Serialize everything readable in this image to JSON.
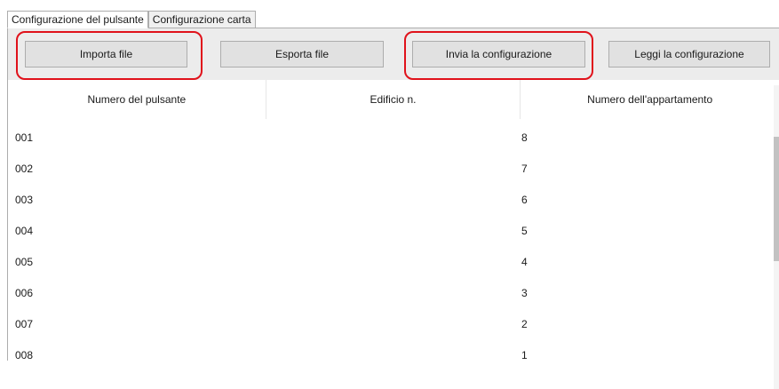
{
  "tabs": [
    {
      "label": "Configurazione del pulsante",
      "active": true
    },
    {
      "label": "Configurazione carta",
      "active": false
    }
  ],
  "toolbar": {
    "import_label": "Importa file",
    "export_label": "Esporta file",
    "send_label": "Invia la configurazione",
    "read_label": "Leggi la configurazione",
    "highlight_color": "#e0121b"
  },
  "table": {
    "columns": [
      "Numero del pulsante",
      "Edificio n.",
      "Numero dell'appartamento"
    ],
    "rows": [
      {
        "button": "001",
        "building": "",
        "apartment": "8"
      },
      {
        "button": "002",
        "building": "",
        "apartment": "7"
      },
      {
        "button": "003",
        "building": "",
        "apartment": "6"
      },
      {
        "button": "004",
        "building": "",
        "apartment": "5"
      },
      {
        "button": "005",
        "building": "",
        "apartment": "4"
      },
      {
        "button": "006",
        "building": "",
        "apartment": "3"
      },
      {
        "button": "007",
        "building": "",
        "apartment": "2"
      },
      {
        "button": "008",
        "building": "",
        "apartment": "1"
      }
    ]
  }
}
